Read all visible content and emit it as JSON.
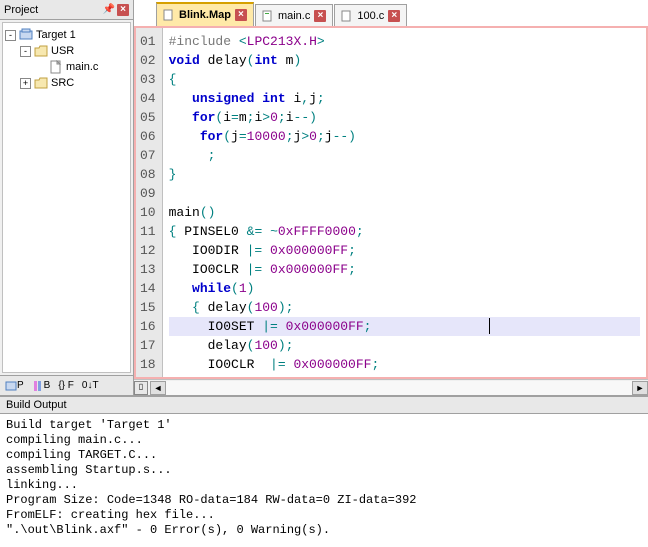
{
  "project_panel": {
    "title": "Project",
    "tree": {
      "root": "Target 1",
      "usr": "USR",
      "mainc": "main.c",
      "src": "SRC"
    },
    "tabs": {
      "p": "P",
      "b": "B",
      "f": "{} F",
      "t": "0↓T"
    }
  },
  "editor": {
    "tabs": [
      {
        "label": "Blink.Map",
        "active": true
      },
      {
        "label": "main.c",
        "active": false
      },
      {
        "label": "100.c",
        "active": false
      }
    ],
    "code": [
      {
        "n": "01",
        "seg": [
          {
            "c": "pp",
            "t": "#include"
          },
          {
            "c": "",
            "t": " "
          },
          {
            "c": "op",
            "t": "<"
          },
          {
            "c": "str",
            "t": "LPC213X.H"
          },
          {
            "c": "op",
            "t": ">"
          }
        ]
      },
      {
        "n": "02",
        "seg": [
          {
            "c": "kw",
            "t": "void"
          },
          {
            "c": "",
            "t": " delay"
          },
          {
            "c": "br",
            "t": "("
          },
          {
            "c": "kw",
            "t": "int"
          },
          {
            "c": "",
            "t": " m"
          },
          {
            "c": "br",
            "t": ")"
          }
        ]
      },
      {
        "n": "03",
        "seg": [
          {
            "c": "br",
            "t": "{"
          }
        ]
      },
      {
        "n": "04",
        "seg": [
          {
            "c": "",
            "t": "   "
          },
          {
            "c": "kw",
            "t": "unsigned"
          },
          {
            "c": "",
            "t": " "
          },
          {
            "c": "kw",
            "t": "int"
          },
          {
            "c": "",
            "t": " i"
          },
          {
            "c": "op",
            "t": ","
          },
          {
            "c": "",
            "t": "j"
          },
          {
            "c": "op",
            "t": ";"
          }
        ]
      },
      {
        "n": "05",
        "seg": [
          {
            "c": "",
            "t": "   "
          },
          {
            "c": "kw",
            "t": "for"
          },
          {
            "c": "br",
            "t": "("
          },
          {
            "c": "",
            "t": "i"
          },
          {
            "c": "op",
            "t": "="
          },
          {
            "c": "",
            "t": "m"
          },
          {
            "c": "op",
            "t": ";"
          },
          {
            "c": "",
            "t": "i"
          },
          {
            "c": "op",
            "t": ">"
          },
          {
            "c": "num",
            "t": "0"
          },
          {
            "c": "op",
            "t": ";"
          },
          {
            "c": "",
            "t": "i"
          },
          {
            "c": "op",
            "t": "--"
          },
          {
            "c": "br",
            "t": ")"
          }
        ]
      },
      {
        "n": "06",
        "seg": [
          {
            "c": "",
            "t": "    "
          },
          {
            "c": "kw",
            "t": "for"
          },
          {
            "c": "br",
            "t": "("
          },
          {
            "c": "",
            "t": "j"
          },
          {
            "c": "op",
            "t": "="
          },
          {
            "c": "num",
            "t": "10000"
          },
          {
            "c": "op",
            "t": ";"
          },
          {
            "c": "",
            "t": "j"
          },
          {
            "c": "op",
            "t": ">"
          },
          {
            "c": "num",
            "t": "0"
          },
          {
            "c": "op",
            "t": ";"
          },
          {
            "c": "",
            "t": "j"
          },
          {
            "c": "op",
            "t": "--"
          },
          {
            "c": "br",
            "t": ")"
          }
        ]
      },
      {
        "n": "07",
        "seg": [
          {
            "c": "",
            "t": "     "
          },
          {
            "c": "op",
            "t": ";"
          }
        ]
      },
      {
        "n": "08",
        "seg": [
          {
            "c": "br",
            "t": "}"
          }
        ]
      },
      {
        "n": "09",
        "seg": []
      },
      {
        "n": "10",
        "seg": [
          {
            "c": "",
            "t": "main"
          },
          {
            "c": "br",
            "t": "()"
          }
        ]
      },
      {
        "n": "11",
        "seg": [
          {
            "c": "br",
            "t": "{"
          },
          {
            "c": "",
            "t": " PINSEL0 "
          },
          {
            "c": "op",
            "t": "&="
          },
          {
            "c": "",
            "t": " "
          },
          {
            "c": "op",
            "t": "~"
          },
          {
            "c": "num",
            "t": "0xFFFF0000"
          },
          {
            "c": "op",
            "t": ";"
          }
        ]
      },
      {
        "n": "12",
        "seg": [
          {
            "c": "",
            "t": "   IO0DIR "
          },
          {
            "c": "op",
            "t": "|="
          },
          {
            "c": "",
            "t": " "
          },
          {
            "c": "num",
            "t": "0x000000FF"
          },
          {
            "c": "op",
            "t": ";"
          }
        ]
      },
      {
        "n": "13",
        "seg": [
          {
            "c": "",
            "t": "   IO0CLR "
          },
          {
            "c": "op",
            "t": "|="
          },
          {
            "c": "",
            "t": " "
          },
          {
            "c": "num",
            "t": "0x000000FF"
          },
          {
            "c": "op",
            "t": ";"
          }
        ]
      },
      {
        "n": "14",
        "seg": [
          {
            "c": "",
            "t": "   "
          },
          {
            "c": "kw",
            "t": "while"
          },
          {
            "c": "br",
            "t": "("
          },
          {
            "c": "num",
            "t": "1"
          },
          {
            "c": "br",
            "t": ")"
          }
        ]
      },
      {
        "n": "15",
        "seg": [
          {
            "c": "",
            "t": "   "
          },
          {
            "c": "br",
            "t": "{"
          },
          {
            "c": "",
            "t": " delay"
          },
          {
            "c": "br",
            "t": "("
          },
          {
            "c": "num",
            "t": "100"
          },
          {
            "c": "br",
            "t": ")"
          },
          {
            "c": "op",
            "t": ";"
          }
        ]
      },
      {
        "n": "16",
        "hl": true,
        "seg": [
          {
            "c": "",
            "t": "     IO0SET "
          },
          {
            "c": "op",
            "t": "|="
          },
          {
            "c": "",
            "t": " "
          },
          {
            "c": "num",
            "t": "0x000000FF"
          },
          {
            "c": "op",
            "t": ";"
          }
        ]
      },
      {
        "n": "17",
        "seg": [
          {
            "c": "",
            "t": "     delay"
          },
          {
            "c": "br",
            "t": "("
          },
          {
            "c": "num",
            "t": "100"
          },
          {
            "c": "br",
            "t": ")"
          },
          {
            "c": "op",
            "t": ";"
          }
        ]
      },
      {
        "n": "18",
        "seg": [
          {
            "c": "",
            "t": "     IO0CLR  "
          },
          {
            "c": "op",
            "t": "|="
          },
          {
            "c": "",
            "t": " "
          },
          {
            "c": "num",
            "t": "0x000000FF"
          },
          {
            "c": "op",
            "t": ";"
          }
        ]
      }
    ]
  },
  "build": {
    "title": "Build Output",
    "text": "Build target 'Target 1'\ncompiling main.c...\ncompiling TARGET.C...\nassembling Startup.s...\nlinking...\nProgram Size: Code=1348 RO-data=184 RW-data=0 ZI-data=392\nFromELF: creating hex file...\n\".\\out\\Blink.axf\" - 0 Error(s), 0 Warning(s)."
  }
}
